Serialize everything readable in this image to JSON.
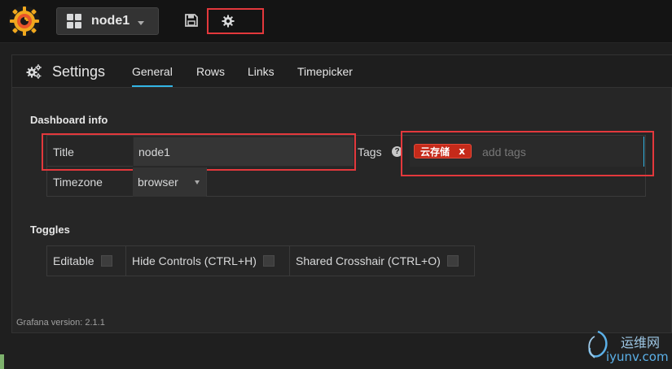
{
  "navbar": {
    "logo_icon": "grafana-logo",
    "dashboard_name": "node1",
    "save_icon": "floppy-disk-icon",
    "settings_icon": "gear-icon"
  },
  "settings": {
    "title": "Settings",
    "tabs": [
      {
        "label": "General",
        "active": true
      },
      {
        "label": "Rows",
        "active": false
      },
      {
        "label": "Links",
        "active": false
      },
      {
        "label": "Timepicker",
        "active": false
      }
    ],
    "dashboard_info": {
      "section_title": "Dashboard info",
      "title_label": "Title",
      "title_value": "node1",
      "tags_label": "Tags",
      "help_glyph": "?",
      "tags": [
        {
          "label": "云存储",
          "remove": "x"
        }
      ],
      "tags_placeholder": "add tags",
      "timezone_label": "Timezone",
      "timezone_value": "browser"
    },
    "toggles": {
      "section_title": "Toggles",
      "items": [
        {
          "label": "Editable",
          "checked": false
        },
        {
          "label": "Hide Controls (CTRL+H)",
          "checked": false
        },
        {
          "label": "Shared Crosshair (CTRL+O)",
          "checked": false
        }
      ]
    },
    "version": "Grafana version: 2.1.1"
  },
  "watermark": {
    "top": "运维网",
    "bottom": "iyunv.com"
  },
  "colors": {
    "accent": "#33b5e5",
    "highlight": "#e3383c",
    "tag": "#c52a1a"
  }
}
